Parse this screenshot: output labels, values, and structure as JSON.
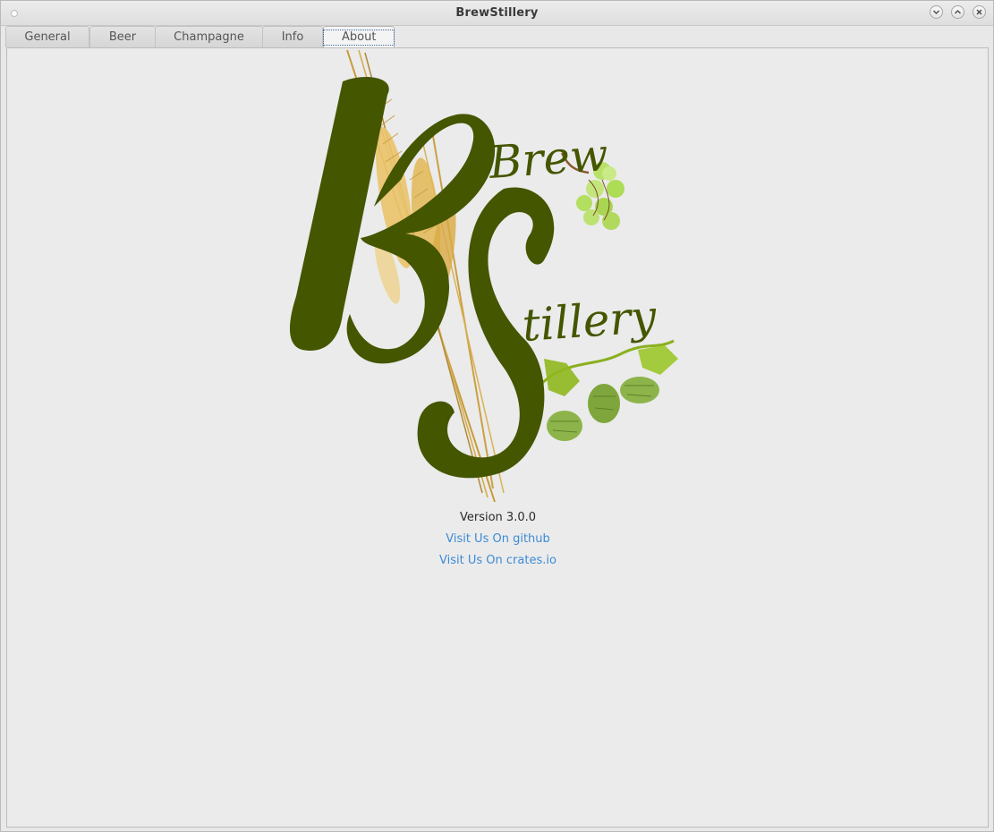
{
  "window": {
    "title": "BrewStillery",
    "controls": [
      "minimize-icon",
      "maximize-icon",
      "close-icon"
    ]
  },
  "tabs": [
    {
      "label": "General",
      "active": false
    },
    {
      "label": "Beer",
      "active": false
    },
    {
      "label": "Champagne",
      "active": false
    },
    {
      "label": "Info",
      "active": false
    },
    {
      "label": "About",
      "active": true
    }
  ],
  "about": {
    "logo_text_brew": "Brew",
    "logo_text_stillery": "Stillery",
    "logo_monogram": "BS",
    "version": "Version 3.0.0",
    "link_github": "Visit Us On github",
    "link_crates": "Visit Us On crates.io"
  },
  "colors": {
    "logo_dark_green": "#445600",
    "hop_green": "#8fb81e",
    "grape_green": "#b9e06a",
    "wheat_gold": "#e7b94a",
    "link_blue": "#3d8bd6"
  }
}
